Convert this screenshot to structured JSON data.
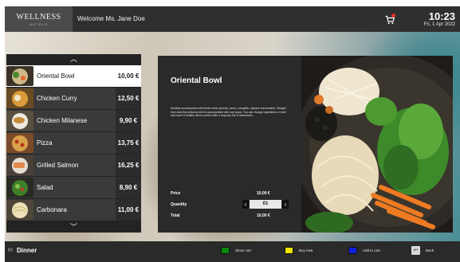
{
  "header": {
    "logo": {
      "name": "WELLNESS",
      "sub": "HOTELS"
    },
    "welcome": "Welcome Ms. Jane Doe",
    "cart_icon": "shopping-cart-icon",
    "time": "10:23",
    "date": "Fri, 1 Apr 2022"
  },
  "menu": {
    "scroll_up_icon": "chevron-up-icon",
    "scroll_down_icon": "chevron-down-icon",
    "items": [
      {
        "name": "Oriental Bowl",
        "price": "10,00 €",
        "selected": true
      },
      {
        "name": "Chicken Curry",
        "price": "12,50 €",
        "selected": false
      },
      {
        "name": "Chicken Milanese",
        "price": "9,90 €",
        "selected": false
      },
      {
        "name": "Pizza",
        "price": "13,75 €",
        "selected": false
      },
      {
        "name": "Grilled Salmon",
        "price": "16,25 €",
        "selected": false
      },
      {
        "name": "Salad",
        "price": "8,90 €",
        "selected": false
      },
      {
        "name": "Carbonara",
        "price": "11,00 €",
        "selected": false
      }
    ]
  },
  "detail": {
    "title": "Oriental Bowl",
    "description": "Noodles accompanied with tender bean sprouts, carrot, courgette, spinach and sesame. Straight from Asia this delicious dish is accompanied with soy sauce. You can change ingredients or even add more! A healthy dinner perfect after a long day full of adventures.",
    "price_label": "Price",
    "price_value": "10,00 €",
    "quantity_label": "Quantity",
    "quantity_value": "01",
    "total_label": "Total",
    "total_value": "10,00 €"
  },
  "footer": {
    "category_icon": "tray-icon",
    "category": "Dinner",
    "actions": [
      {
        "label": "Show cart",
        "color": "#0a8a0a"
      },
      {
        "label": "Buy now",
        "color": "#f2e600"
      },
      {
        "label": "Add to cart",
        "color": "#1020e0"
      }
    ],
    "back_label": "Back",
    "back_icon": "back-icon"
  },
  "colors": {
    "header_bg": "#2f2f2f",
    "panel_bg": "#2a2a2a",
    "selected_row": "#ffffff"
  }
}
